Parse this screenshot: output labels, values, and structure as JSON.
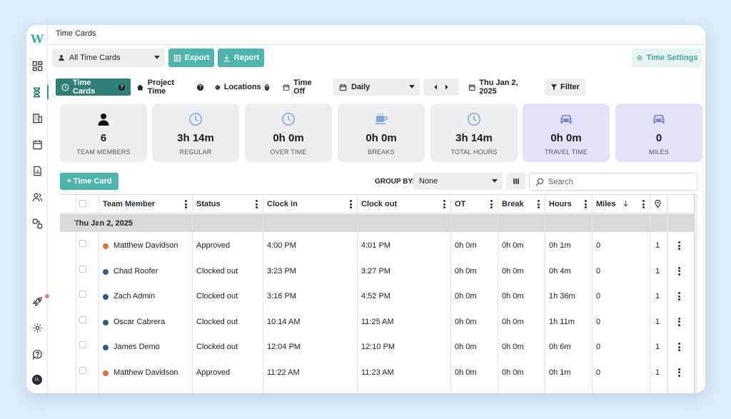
{
  "app": {
    "title": "Time Cards",
    "logo": "W"
  },
  "sidebar": {
    "items": [
      {
        "name": "dashboard-icon"
      },
      {
        "name": "hourglass-icon",
        "active": true
      },
      {
        "name": "building-icon"
      },
      {
        "name": "calendar-icon"
      },
      {
        "name": "report-icon"
      },
      {
        "name": "users-icon"
      },
      {
        "name": "integrations-icon"
      },
      {
        "name": "rocket-icon"
      },
      {
        "name": "settings-icon"
      },
      {
        "name": "help-icon"
      }
    ],
    "avatar": "LL"
  },
  "toolbar": {
    "timecard_select": "All Time Cards",
    "export_label": "Export",
    "report_label": "Report",
    "settings_label": "Time Settings"
  },
  "nav": {
    "tabs": [
      {
        "label": "Time Cards",
        "active": true
      },
      {
        "label": "Project Time"
      },
      {
        "label": "Locations"
      },
      {
        "label": "Time Off"
      }
    ],
    "period_select": "Daily",
    "date_label": "Thu Jan 2, 2025",
    "filter_label": "Filter"
  },
  "stats": [
    {
      "value": "6",
      "label": "TEAM MEMBERS",
      "icon": "person-icon"
    },
    {
      "value": "3h 14m",
      "label": "REGULAR",
      "icon": "clock-icon"
    },
    {
      "value": "0h 0m",
      "label": "OVER TIME",
      "icon": "clock-icon"
    },
    {
      "value": "0h 0m",
      "label": "BREAKS",
      "icon": "coffee-icon"
    },
    {
      "value": "3h 14m",
      "label": "TOTAL HOURS",
      "icon": "clock-icon"
    },
    {
      "value": "0h 0m",
      "label": "TRAVEL TIME",
      "icon": "car-icon"
    },
    {
      "value": "0",
      "label": "MILES",
      "icon": "car-icon"
    }
  ],
  "table_toolbar": {
    "add_label": "+ Time Card",
    "group_by_label": "GROUP BY:",
    "group_by_value": "None",
    "search_placeholder": "Search"
  },
  "table": {
    "columns": [
      "Team Member",
      "Status",
      "Clock in",
      "Clock out",
      "OT",
      "Break",
      "Hours",
      "Miles"
    ],
    "group": "Thu Jan 2, 2025",
    "colors": {
      "approved": "#e0733f",
      "clocked_out": "#2c5a8c"
    },
    "rows": [
      {
        "name": "Matthew Davidson",
        "status": "Approved",
        "clock_in": "4:00 PM",
        "clock_out": "4:01 PM",
        "ot": "0h 0m",
        "break": "0h 0m",
        "hours": "0h 1m",
        "miles": "0",
        "loc": "1"
      },
      {
        "name": "Chad Roofer",
        "status": "Clocked out",
        "clock_in": "3:23 PM",
        "clock_out": "3:27 PM",
        "ot": "0h 0m",
        "break": "0h 0m",
        "hours": "0h 4m",
        "miles": "0",
        "loc": "1"
      },
      {
        "name": "Zach Admin",
        "status": "Clocked out",
        "clock_in": "3:16 PM",
        "clock_out": "4:52 PM",
        "ot": "0h 0m",
        "break": "0h 0m",
        "hours": "1h 36m",
        "miles": "0",
        "loc": "1"
      },
      {
        "name": "Oscar Cabrera",
        "status": "Clocked out",
        "clock_in": "10:14 AM",
        "clock_out": "11:25 AM",
        "ot": "0h 0m",
        "break": "0h 0m",
        "hours": "1h 11m",
        "miles": "0",
        "loc": "1"
      },
      {
        "name": "James Demo",
        "status": "Clocked out",
        "clock_in": "12:04 PM",
        "clock_out": "12:10 PM",
        "ot": "0h 0m",
        "break": "0h 0m",
        "hours": "0h 6m",
        "miles": "0",
        "loc": "1"
      },
      {
        "name": "Matthew Davidson",
        "status": "Approved",
        "clock_in": "11:22 AM",
        "clock_out": "11:23 AM",
        "ot": "0h 0m",
        "break": "0h 0m",
        "hours": "0h 1m",
        "miles": "0",
        "loc": "1"
      }
    ]
  }
}
